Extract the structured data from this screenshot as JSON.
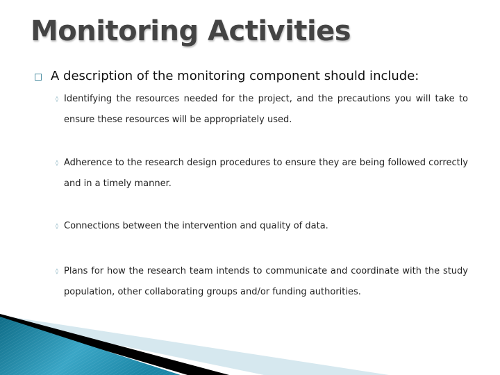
{
  "slide": {
    "title": "Monitoring Activities",
    "main_point": "A description of the monitoring component should include:",
    "sub_points": [
      "Identifying the resources needed for the project, and the precautions you will take to ensure these resources will be appropriately used.",
      "Adherence to the research design procedures to ensure they are being followed correctly and in a timely manner.",
      "Connections between the intervention and quality of data.",
      "Plans for how the research team intends to communicate and coordinate with the study population, other collaborating groups and/or funding authorities."
    ],
    "bullet_level1_icon": "square-outline-icon",
    "bullet_level2_icon": "small-diamond-icon"
  },
  "theme": {
    "title_color": "#444444",
    "accent_teal": "#1a7f9c",
    "accent_light": "#d6e8ef",
    "bullet_color": "#4f8fa3"
  }
}
